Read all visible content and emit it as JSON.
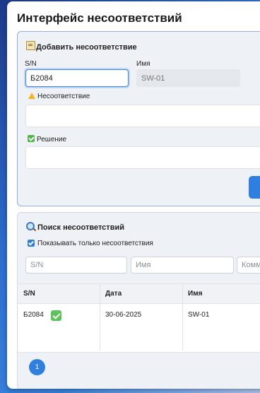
{
  "app": {
    "title": "Интерфейс несоответствий"
  },
  "add_form": {
    "title": "Добавить несоответствие",
    "sn_label": "S/N",
    "sn_value": "Б2084",
    "name_label": "Имя",
    "name_value": "SW-01",
    "nc_label": "Несоответствие",
    "nc_value": "",
    "solution_label": "Решение",
    "solution_value": ""
  },
  "search": {
    "title": "Поиск несоответствий",
    "only_nc_label": "Показывать только несоответствия",
    "only_nc_checked": true,
    "filter_sn_placeholder": "S/N",
    "filter_name_placeholder": "Имя",
    "filter_comment_placeholder": "Комм"
  },
  "table": {
    "headers": {
      "sn": "S/N",
      "date": "Дата",
      "name": "Имя"
    },
    "rows": [
      {
        "sn": "Б2084",
        "status": "check",
        "date": "30-06-2025",
        "name": "SW-01"
      }
    ]
  },
  "pagination": {
    "current": "1"
  },
  "colors": {
    "accent": "#2f7fe0",
    "check": "#5cc25a",
    "warning": "#f2b623"
  }
}
